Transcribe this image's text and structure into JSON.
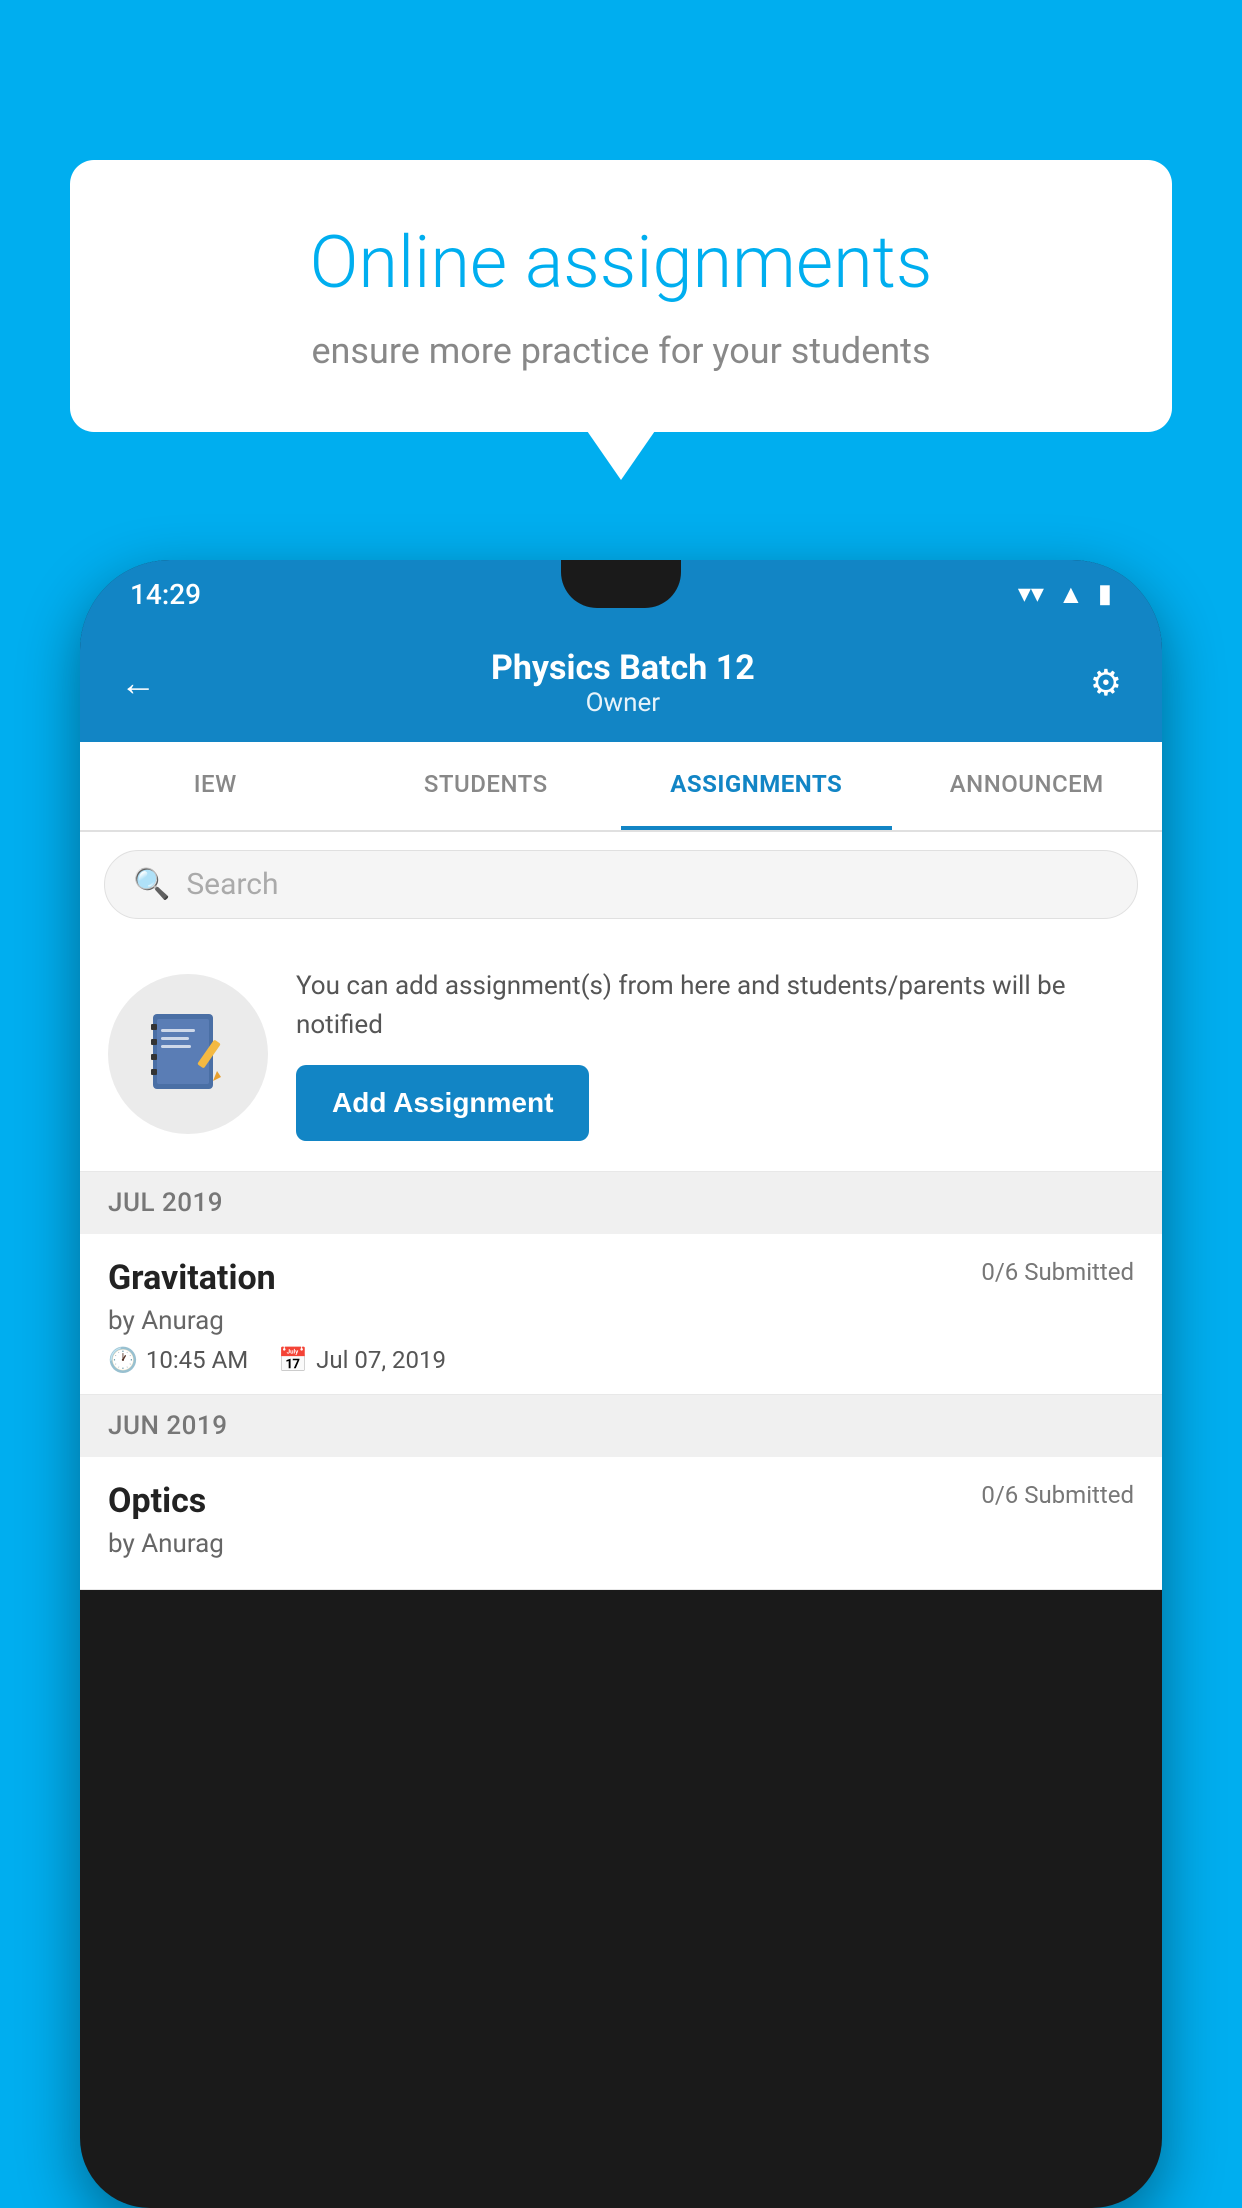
{
  "background": {
    "color": "#00AEEF"
  },
  "speech_bubble": {
    "title": "Online assignments",
    "subtitle": "ensure more practice for your students"
  },
  "status_bar": {
    "time": "14:29",
    "wifi_icon": "wifi",
    "signal_icon": "signal",
    "battery_icon": "battery"
  },
  "app_header": {
    "back_label": "←",
    "title": "Physics Batch 12",
    "subtitle": "Owner",
    "settings_icon": "⚙"
  },
  "tabs": [
    {
      "label": "IEW",
      "active": false
    },
    {
      "label": "STUDENTS",
      "active": false
    },
    {
      "label": "ASSIGNMENTS",
      "active": true
    },
    {
      "label": "ANNOUNCEM...",
      "active": false
    }
  ],
  "search": {
    "placeholder": "Search",
    "icon": "🔍"
  },
  "assignment_promo": {
    "description": "You can add assignment(s) from here and students/parents will be notified",
    "add_button_label": "Add Assignment"
  },
  "sections": [
    {
      "label": "JUL 2019",
      "assignments": [
        {
          "name": "Gravitation",
          "submitted": "0/6 Submitted",
          "by": "by Anurag",
          "time": "10:45 AM",
          "date": "Jul 07, 2019"
        }
      ]
    },
    {
      "label": "JUN 2019",
      "assignments": [
        {
          "name": "Optics",
          "submitted": "0/6 Submitted",
          "by": "by Anurag",
          "time": "",
          "date": ""
        }
      ]
    }
  ]
}
